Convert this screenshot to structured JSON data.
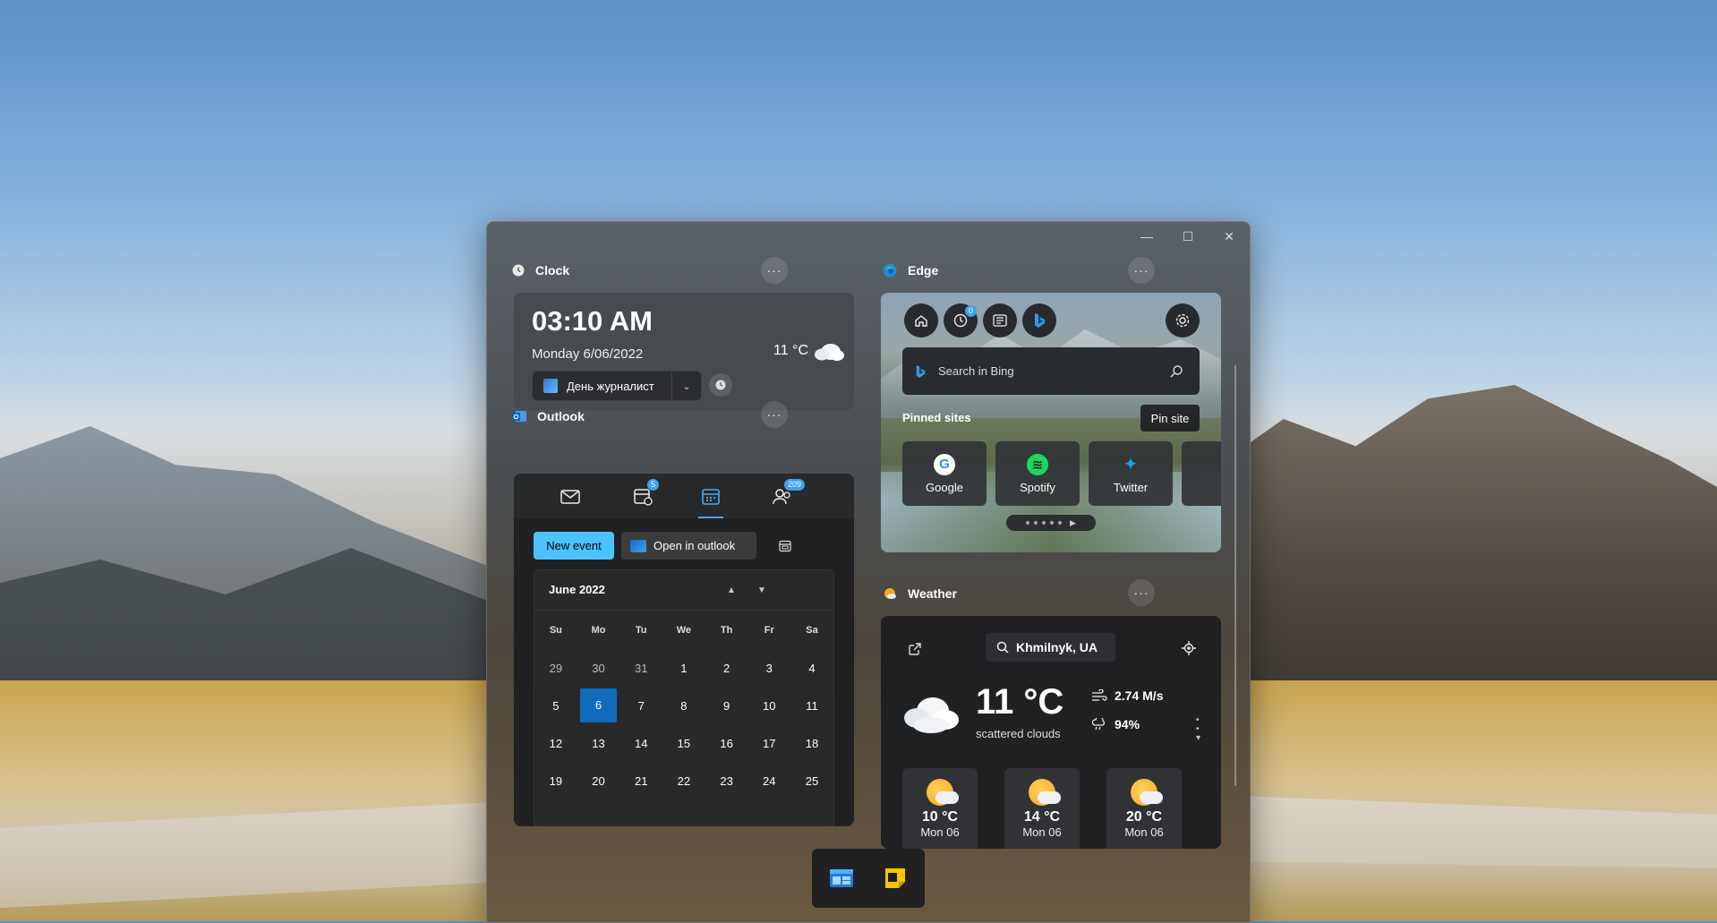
{
  "window": {
    "minimize": "—",
    "maximize": "☐",
    "close": "✕"
  },
  "clock": {
    "title": "Clock",
    "time": "03:10 AM",
    "date": "Monday 6/06/2022",
    "temp": "11 °C",
    "timezone": "День журналист"
  },
  "outlook": {
    "title": "Outlook",
    "badges": {
      "events": "5",
      "people": "209"
    },
    "new_event": "New event",
    "open_in_outlook": "Open in outlook",
    "calendar": {
      "month": "June 2022",
      "weekdays": [
        "Su",
        "Mo",
        "Tu",
        "We",
        "Th",
        "Fr",
        "Sa"
      ],
      "weeks": [
        [
          "29",
          "30",
          "31",
          "1",
          "2",
          "3",
          "4"
        ],
        [
          "5",
          "6",
          "7",
          "8",
          "9",
          "10",
          "11"
        ],
        [
          "12",
          "13",
          "14",
          "15",
          "16",
          "17",
          "18"
        ],
        [
          "19",
          "20",
          "21",
          "22",
          "23",
          "24",
          "25"
        ]
      ],
      "selected_day": "6"
    }
  },
  "edge": {
    "title": "Edge",
    "history_badge": "0",
    "search_placeholder": "Search in Bing",
    "pinned_label": "Pinned sites",
    "pin_site": "Pin site",
    "sites": [
      {
        "name": "Google",
        "color": "#ffffff",
        "glyph": "G"
      },
      {
        "name": "Spotify",
        "color": "#1ed760",
        "glyph": "≋"
      },
      {
        "name": "Twitter",
        "color": "#1d9bf0",
        "glyph": "✦"
      }
    ]
  },
  "weather": {
    "title": "Weather",
    "location": "Khmilnyk, UA",
    "temp": "11 °C",
    "description": "scattered clouds",
    "wind": "2.74  M/s",
    "humidity": "94%",
    "forecast": [
      {
        "temp": "10 °C",
        "day": "Mon 06",
        "icon": "sun-cloud-icon"
      },
      {
        "temp": "14 °C",
        "day": "Mon 06",
        "icon": "sun-cloud-icon"
      },
      {
        "temp": "20 °C",
        "day": "Mon 06",
        "icon": "sun-cloud-icon"
      }
    ]
  }
}
